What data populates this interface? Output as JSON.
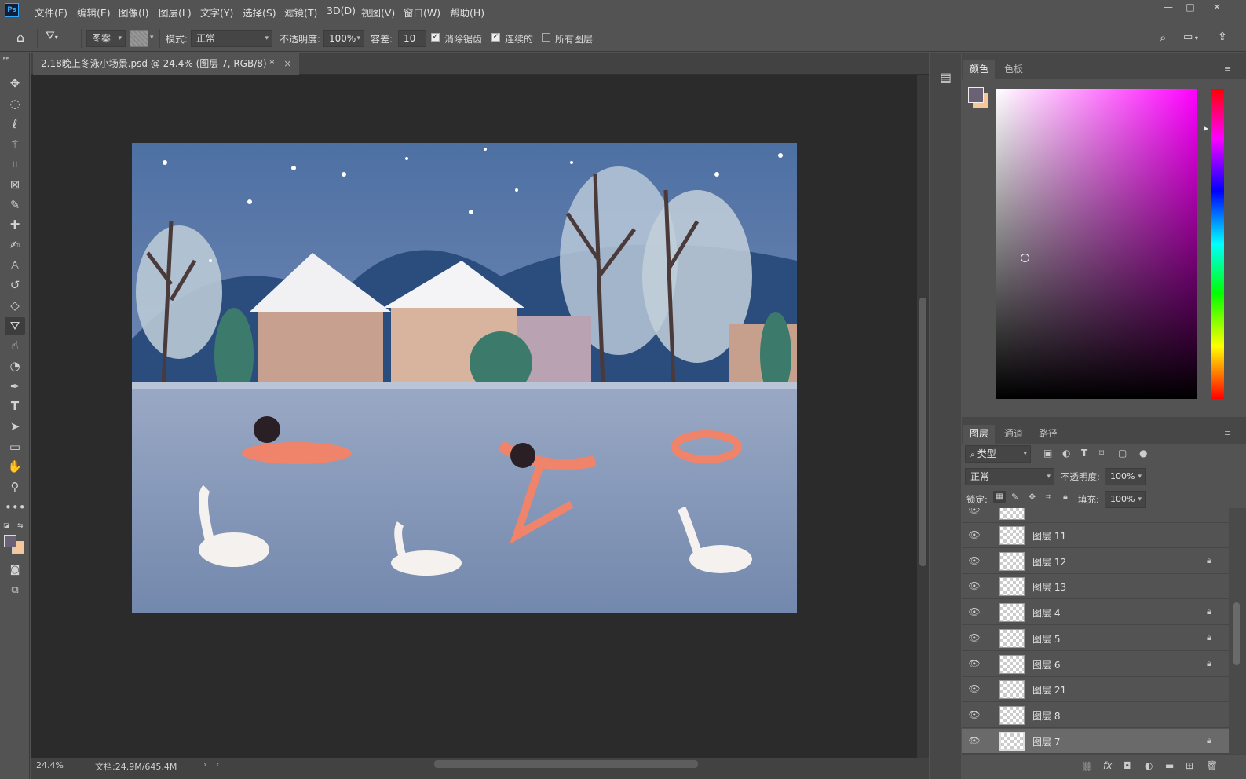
{
  "menubar": {
    "logo": "Ps",
    "items": [
      "文件(F)",
      "编辑(E)",
      "图像(I)",
      "图层(L)",
      "文字(Y)",
      "选择(S)",
      "滤镜(T)",
      "3D(D)",
      "视图(V)",
      "窗口(W)",
      "帮助(H)"
    ],
    "window_buttons": [
      "—",
      "□",
      "✕"
    ]
  },
  "options": {
    "fill_source": "图案",
    "mode_label": "模式:",
    "mode_value": "正常",
    "opacity_label": "不透明度:",
    "opacity_value": "100%",
    "tolerance_label": "容差:",
    "tolerance_value": "10",
    "antialias_label": "消除锯齿",
    "contiguous_label": "连续的",
    "all_layers_label": "所有图层",
    "antialias_checked": true,
    "contiguous_checked": true,
    "all_layers_checked": false
  },
  "tools": [
    "move-icon",
    "marquee-icon",
    "lasso-icon",
    "magic-wand-icon",
    "crop-icon",
    "frame-icon",
    "eyedropper-icon",
    "healing-icon",
    "brush-icon",
    "stamp-icon",
    "history-brush-icon",
    "eraser-icon",
    "paint-bucket-icon",
    "smudge-icon",
    "dodge-icon",
    "pen-icon",
    "type-icon",
    "path-select-icon",
    "rectangle-icon",
    "hand-icon",
    "zoom-icon",
    "more-icon"
  ],
  "document": {
    "tab_title": "2.18晚上冬泳小场景.psd @ 24.4% (图层 7, RGB/8) *",
    "close": "×"
  },
  "status": {
    "zoom": "24.4%",
    "doc_info": "文档:24.9M/645.4M"
  },
  "color_panel": {
    "tabs": [
      "颜色",
      "色板"
    ],
    "foreground": "#6b6175",
    "background": "#f6c79a",
    "hue_color": "#ff00ff"
  },
  "layers_panel": {
    "tabs": [
      "图层",
      "通道",
      "路径"
    ],
    "filter_label": "类型",
    "blend_mode": "正常",
    "opacity_label": "不透明度:",
    "opacity_value": "100%",
    "lock_label": "锁定:",
    "fill_label": "填充:",
    "fill_value": "100%",
    "layers": [
      {
        "name": "图层 11",
        "locked": false,
        "selected": false
      },
      {
        "name": "图层 12",
        "locked": true,
        "selected": false
      },
      {
        "name": "图层 13",
        "locked": false,
        "selected": false
      },
      {
        "name": "图层 4",
        "locked": true,
        "selected": false
      },
      {
        "name": "图层 5",
        "locked": true,
        "selected": false
      },
      {
        "name": "图层 6",
        "locked": true,
        "selected": false
      },
      {
        "name": "图层 21",
        "locked": false,
        "selected": false
      },
      {
        "name": "图层 8",
        "locked": false,
        "selected": false
      },
      {
        "name": "图层 7",
        "locked": true,
        "selected": true
      }
    ]
  },
  "colors": {
    "sky": "#4c6f9e",
    "water": "#7f94b4",
    "accent": "#f0846a"
  }
}
